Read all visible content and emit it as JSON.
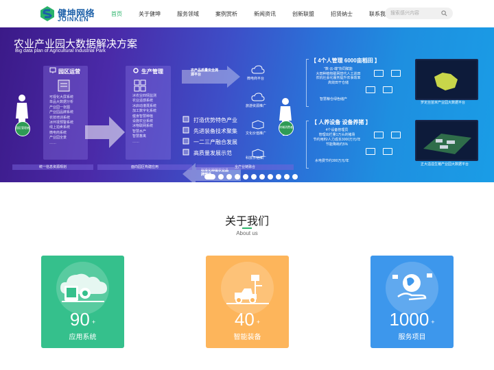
{
  "brand": {
    "name_cn": "健坤网络",
    "name_en": "JOINKEN",
    "colors": {
      "primary": "#1b5fa8",
      "accent": "#2ab36a"
    }
  },
  "nav": {
    "items": [
      {
        "label": "首页",
        "active": true
      },
      {
        "label": "关于健坤"
      },
      {
        "label": "服务领域"
      },
      {
        "label": "案例赏析"
      },
      {
        "label": "新闻资讯"
      },
      {
        "label": "创新联盟"
      },
      {
        "label": "招贤纳士"
      },
      {
        "label": "联系我们"
      }
    ]
  },
  "search": {
    "placeholder": "搜索感兴内容",
    "icon": "search-icon"
  },
  "banner": {
    "title": "农业产业园大数据解决方案",
    "subtitle": "Big data plan of Agricultural Industrial Park",
    "panel1": {
      "title": "园区运营",
      "items": [
        "可视化大屏系统",
        "单品大数据分析",
        "产业园一张图",
        "产业园品牌系统",
        "农技培训系统",
        "冰环境预警系统",
        "线上拍卖系统",
        "微电商系统",
        "产业园全景",
        "……"
      ]
    },
    "panel2": {
      "title": "生产管理",
      "items": [
        "冰农业四情监测",
        "农业遥感系统",
        "冰启动灌溉系统",
        "加工数字化系统",
        "健身智慧种植",
        "设施农业系统",
        "冰物联网系统",
        "智慧水产",
        "智慧畜禽",
        "……"
      ]
    },
    "arrow_top": "农产品质量安全溯源平台",
    "arrow_bottom": "标准化种植农业品牌塑造",
    "features": [
      "打造优势特色产业",
      "先进装备技术聚集",
      "一二三产融合发展",
      "高质量发展示范"
    ],
    "platforms": [
      "微电商平台",
      "旅游资源推广",
      "文化价值推广",
      "科技示范推广"
    ],
    "person_left": "园区管理者",
    "person_right": "终端消费者",
    "bars": [
      "统一信息资源规划",
      "面向园区构建应用",
      "全产业链融合"
    ],
    "block1": {
      "heading": "【 4个人管理 6000亩稻田 】",
      "lines": [
        "\"数-云-端\"协同赋能",
        "大田种植物联网替代人工巡田",
        "农机社会化服务提升农事效率",
        "高效田干仓储"
      ],
      "note": "智慧粮仓绿色储产",
      "caption": "罗定丝苗米产业园大数据平台"
    },
    "block2": {
      "heading": "【 人养设备 设备养猪 】",
      "lines": [
        "4个设备管理员",
        "管理出栏量1万头的猪场",
        "节约用料/人力成本3000万元/年",
        "节能降耗约5%"
      ],
      "note": "水电费节约300万元/年",
      "caption": "正大溢溢生猪产业园大数据平台"
    },
    "slides_count": 11,
    "active_slide": 1
  },
  "about": {
    "title": "关于我们",
    "subtitle": "About us",
    "cards": [
      {
        "number": "90",
        "plus": "+",
        "label": "应用系统",
        "color": "#35c08c",
        "icon": "cloud-monitor-icon"
      },
      {
        "number": "40",
        "plus": "+",
        "label": "智能装备",
        "color": "#fdb55b",
        "icon": "farm-equipment-icon"
      },
      {
        "number": "1000",
        "plus": "+",
        "label": "服务项目",
        "color": "#3d97ec",
        "icon": "globe-hand-icon"
      }
    ]
  }
}
